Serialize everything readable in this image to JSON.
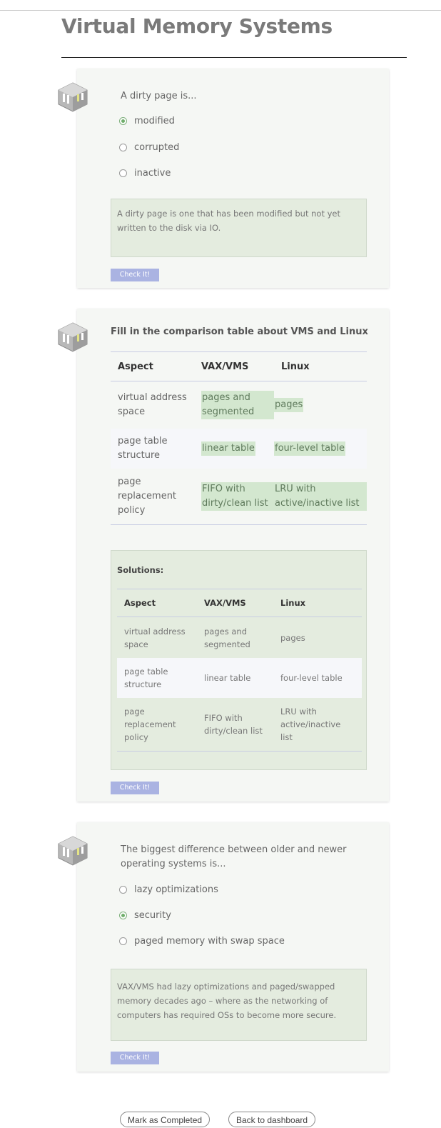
{
  "page": {
    "title": "Virtual Memory Systems"
  },
  "q1": {
    "question": "A dirty page is...",
    "options": [
      {
        "label": "modified",
        "checked": true
      },
      {
        "label": "corrupted",
        "checked": false
      },
      {
        "label": "inactive",
        "checked": false
      }
    ],
    "feedback": "A dirty page is one that has been modified but not yet written to the disk via IO.",
    "check_label": "Check It!"
  },
  "q2": {
    "title": "Fill in the comparison table about VMS and Linux",
    "headers": [
      "Aspect",
      "VAX/VMS",
      "Linux"
    ],
    "rows": [
      {
        "aspect": "virtual address space",
        "vms": "pages and segmented",
        "linux": "pages"
      },
      {
        "aspect": "page table structure",
        "vms": "linear table",
        "linux": "four-level table"
      },
      {
        "aspect": "page replacement policy",
        "vms": "FIFO with dirty/clean list",
        "linux": "LRU with active/inactive list"
      }
    ],
    "solutions_label": "Solutions:",
    "check_label": "Check It!"
  },
  "q3": {
    "question": "The biggest difference between older and newer operating systems is...",
    "options": [
      {
        "label": "lazy optimizations",
        "checked": false
      },
      {
        "label": "security",
        "checked": true
      },
      {
        "label": "paged memory with swap space",
        "checked": false
      }
    ],
    "feedback": "VAX/VMS had lazy optimizations and paged/swapped memory decades ago – where as the networking of computers has required OSs to become more secure.",
    "check_label": "Check It!"
  },
  "footer": {
    "completed_label": "Mark as Completed",
    "dashboard_label": "Back to dashboard"
  },
  "colors": {
    "accent": "#aab3e2",
    "answer_fill": "#d3e7cf",
    "feedback_bg": "#e4ecdf",
    "card_bg": "#f5f7f4"
  }
}
